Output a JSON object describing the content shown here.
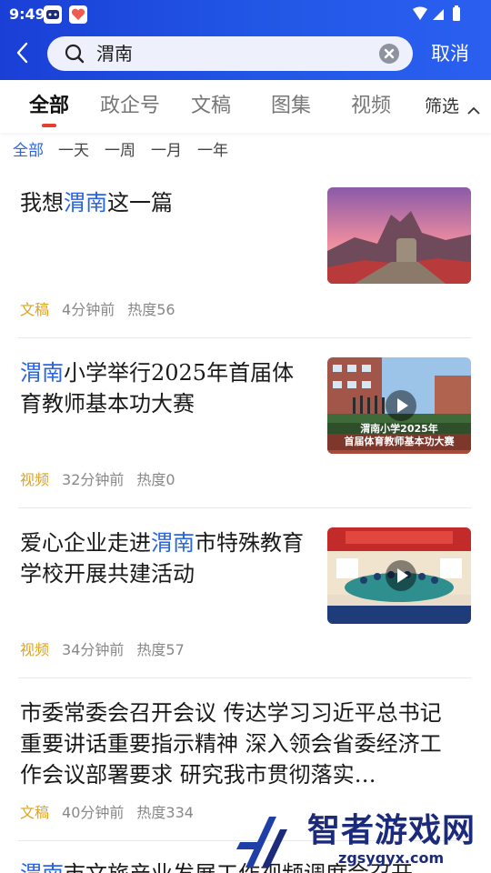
{
  "status_bar": {
    "time": "9:49"
  },
  "search": {
    "query": "渭南",
    "cancel_label": "取消"
  },
  "tabs": [
    {
      "label": "全部",
      "active": true
    },
    {
      "label": "政企号",
      "active": false
    },
    {
      "label": "文稿",
      "active": false
    },
    {
      "label": "图集",
      "active": false
    },
    {
      "label": "视频",
      "active": false
    }
  ],
  "filter_label": "筛选",
  "time_filters": [
    {
      "label": "全部",
      "active": true
    },
    {
      "label": "一天",
      "active": false
    },
    {
      "label": "一周",
      "active": false
    },
    {
      "label": "一月",
      "active": false
    },
    {
      "label": "一年",
      "active": false
    }
  ],
  "news": [
    {
      "title_before": "我想",
      "title_highlight": "渭南",
      "title_after": "这一篇",
      "type": "文稿",
      "time": "4分钟前",
      "heat": "热度56",
      "thumb": "mountain-photo"
    },
    {
      "title_before": "",
      "title_highlight": "渭南",
      "title_after": "小学举行2025年首届体育教师基本功大赛",
      "type": "视频",
      "time": "32分钟前",
      "heat": "热度0",
      "thumb": "video-thumbnail",
      "thumb_caption_1": "渭南小学2025年",
      "thumb_caption_2": "首届体育教师基本功大赛"
    },
    {
      "title_before": "爱心企业走进",
      "title_highlight": "渭南",
      "title_after": "市特殊教育学校开展共建活动",
      "type": "视频",
      "time": "34分钟前",
      "heat": "热度57",
      "thumb": "video-thumbnail"
    },
    {
      "title_before": "市委常委会召开会议 传达学习习近平总书记重要讲话重要指示精神 深入领会省委经济工作会议部署要求 研究我市贯彻落实…",
      "title_highlight": "",
      "title_after": "",
      "type": "文稿",
      "time": "40分钟前",
      "heat": "热度334"
    },
    {
      "title_before": "",
      "title_highlight": "渭南",
      "title_after": "市文旅产业发展工作视频调度会召开"
    }
  ],
  "watermark": {
    "name": "智者游戏网",
    "url": "zgsygyx.com"
  },
  "colors": {
    "header": "#2257e6",
    "highlight": "#2a64e6",
    "type_tag": "#e0a31f",
    "tab_indicator": "#e53f2e"
  }
}
